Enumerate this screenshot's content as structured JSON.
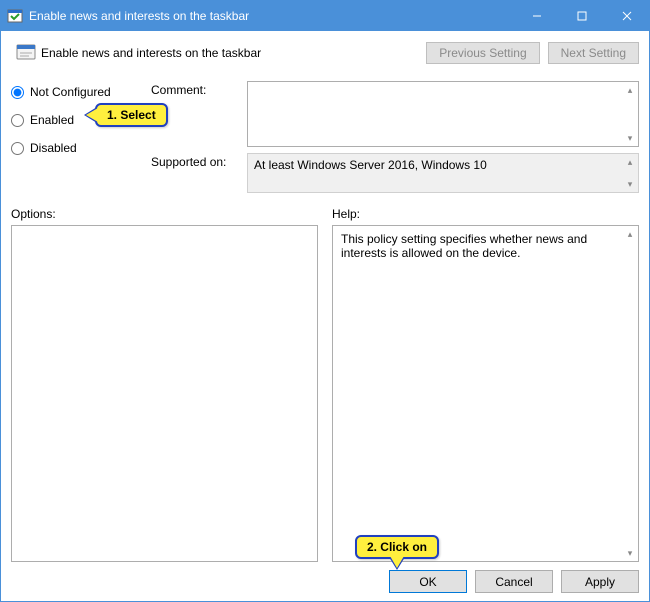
{
  "titlebar": {
    "title": "Enable news and interests on the taskbar"
  },
  "header": {
    "title": "Enable news and interests on the taskbar",
    "prev_label": "Previous Setting",
    "next_label": "Next Setting"
  },
  "radios": {
    "not_configured": "Not Configured",
    "enabled": "Enabled",
    "disabled": "Disabled",
    "selected": "not_configured"
  },
  "fields": {
    "comment_label": "Comment:",
    "comment_value": "",
    "supported_label": "Supported on:",
    "supported_value": "At least Windows Server 2016, Windows 10"
  },
  "panels": {
    "options_label": "Options:",
    "options_text": "",
    "help_label": "Help:",
    "help_text": "This policy setting specifies whether news and interests is allowed on the device."
  },
  "buttons": {
    "ok": "OK",
    "cancel": "Cancel",
    "apply": "Apply"
  },
  "annotations": {
    "step1": "1. Select",
    "step2": "2. Click on"
  }
}
